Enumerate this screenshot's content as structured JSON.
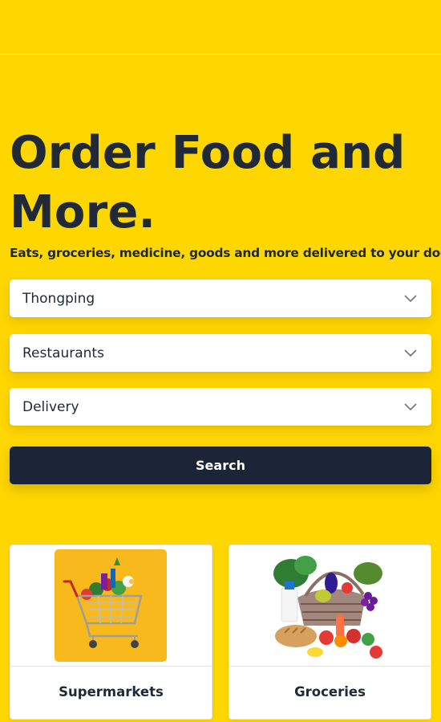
{
  "hero": {
    "title": "Order Food and More.",
    "subtitle": "Eats, groceries, medicine, goods and more delivered to your door!"
  },
  "form": {
    "location": {
      "value": "Thongping",
      "icon": "chevron-down-icon"
    },
    "category": {
      "value": "Restaurants",
      "icon": "chevron-down-icon"
    },
    "mode": {
      "value": "Delivery",
      "icon": "chevron-down-icon"
    },
    "search_label": "Search"
  },
  "categories": [
    {
      "label": "Supermarkets",
      "image": "shopping-cart-groceries-image"
    },
    {
      "label": "Groceries",
      "image": "grocery-basket-image"
    }
  ],
  "colors": {
    "background": "#FFD700",
    "dark": "#1c2537",
    "card": "#ffffff"
  }
}
